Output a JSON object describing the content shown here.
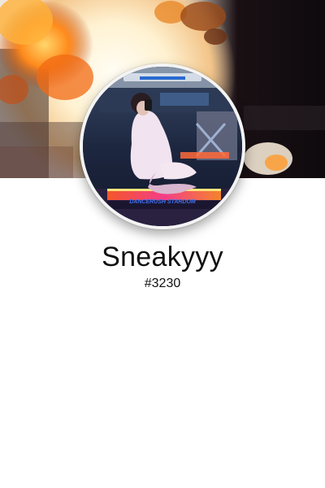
{
  "profile": {
    "username": "Sneakyyy",
    "discriminator": "#3230"
  },
  "avatar": {
    "sign_text": "DANCERUSH STARDOM"
  },
  "colors": {
    "background": "#ffffff",
    "text": "#111111",
    "avatar_ring": "#f4f4f4"
  }
}
